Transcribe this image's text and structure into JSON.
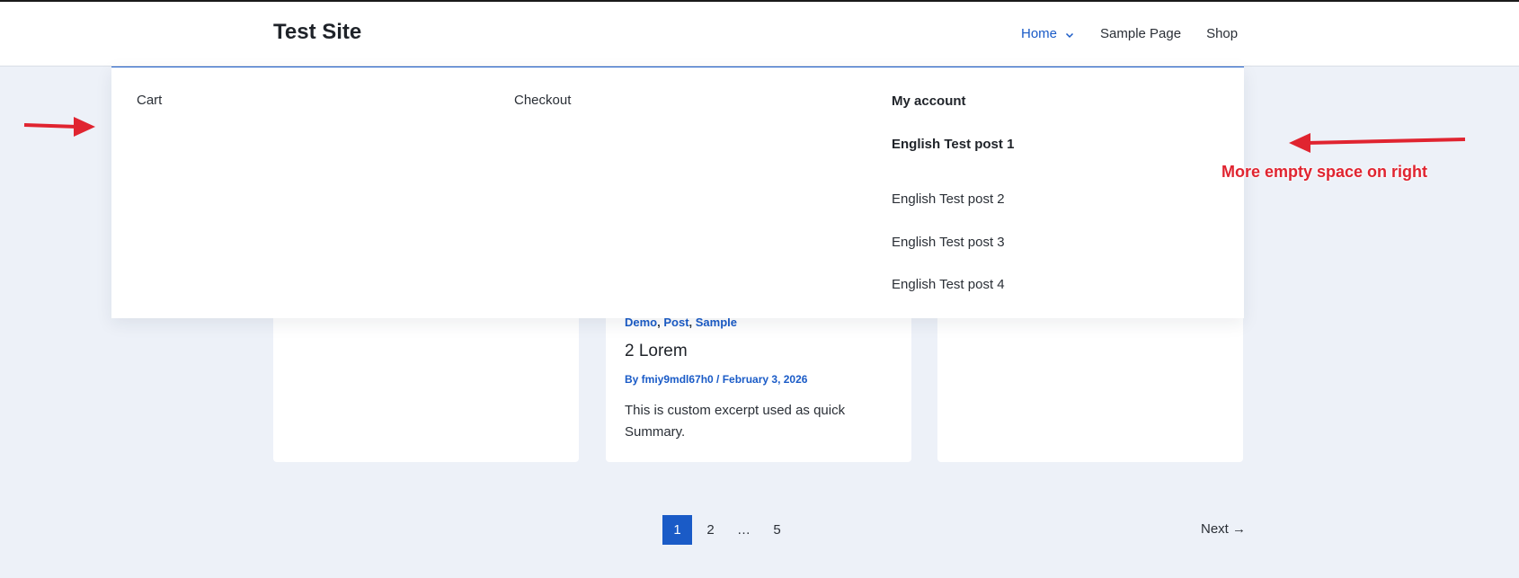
{
  "site": {
    "title": "Test Site"
  },
  "nav": {
    "items": [
      {
        "label": "Home",
        "active": true,
        "has_submenu": true
      },
      {
        "label": "Sample Page"
      },
      {
        "label": "Shop"
      }
    ]
  },
  "mega_menu": {
    "col1": [
      "Cart"
    ],
    "col2": [
      "Checkout"
    ],
    "col3_headings": [
      "My account",
      "English Test post 1"
    ],
    "col3_items": [
      "English Test post 2",
      "English Test post 3",
      "English Test post 4"
    ]
  },
  "post": {
    "categories": [
      "Demo",
      "Post",
      "Sample"
    ],
    "title": "2 Lorem",
    "meta": "By fmiy9mdl67h0 / February 3, 2026",
    "excerpt": "This is custom excerpt used as quick Summary."
  },
  "pagination": {
    "pages": [
      "1",
      "2",
      "…",
      "5"
    ],
    "current": "1",
    "next_label": "Next →"
  },
  "annotation": {
    "text": "More empty space on right",
    "color": "#e02430"
  },
  "colors": {
    "accent": "#1a5bc7",
    "background": "#edf1f8"
  }
}
